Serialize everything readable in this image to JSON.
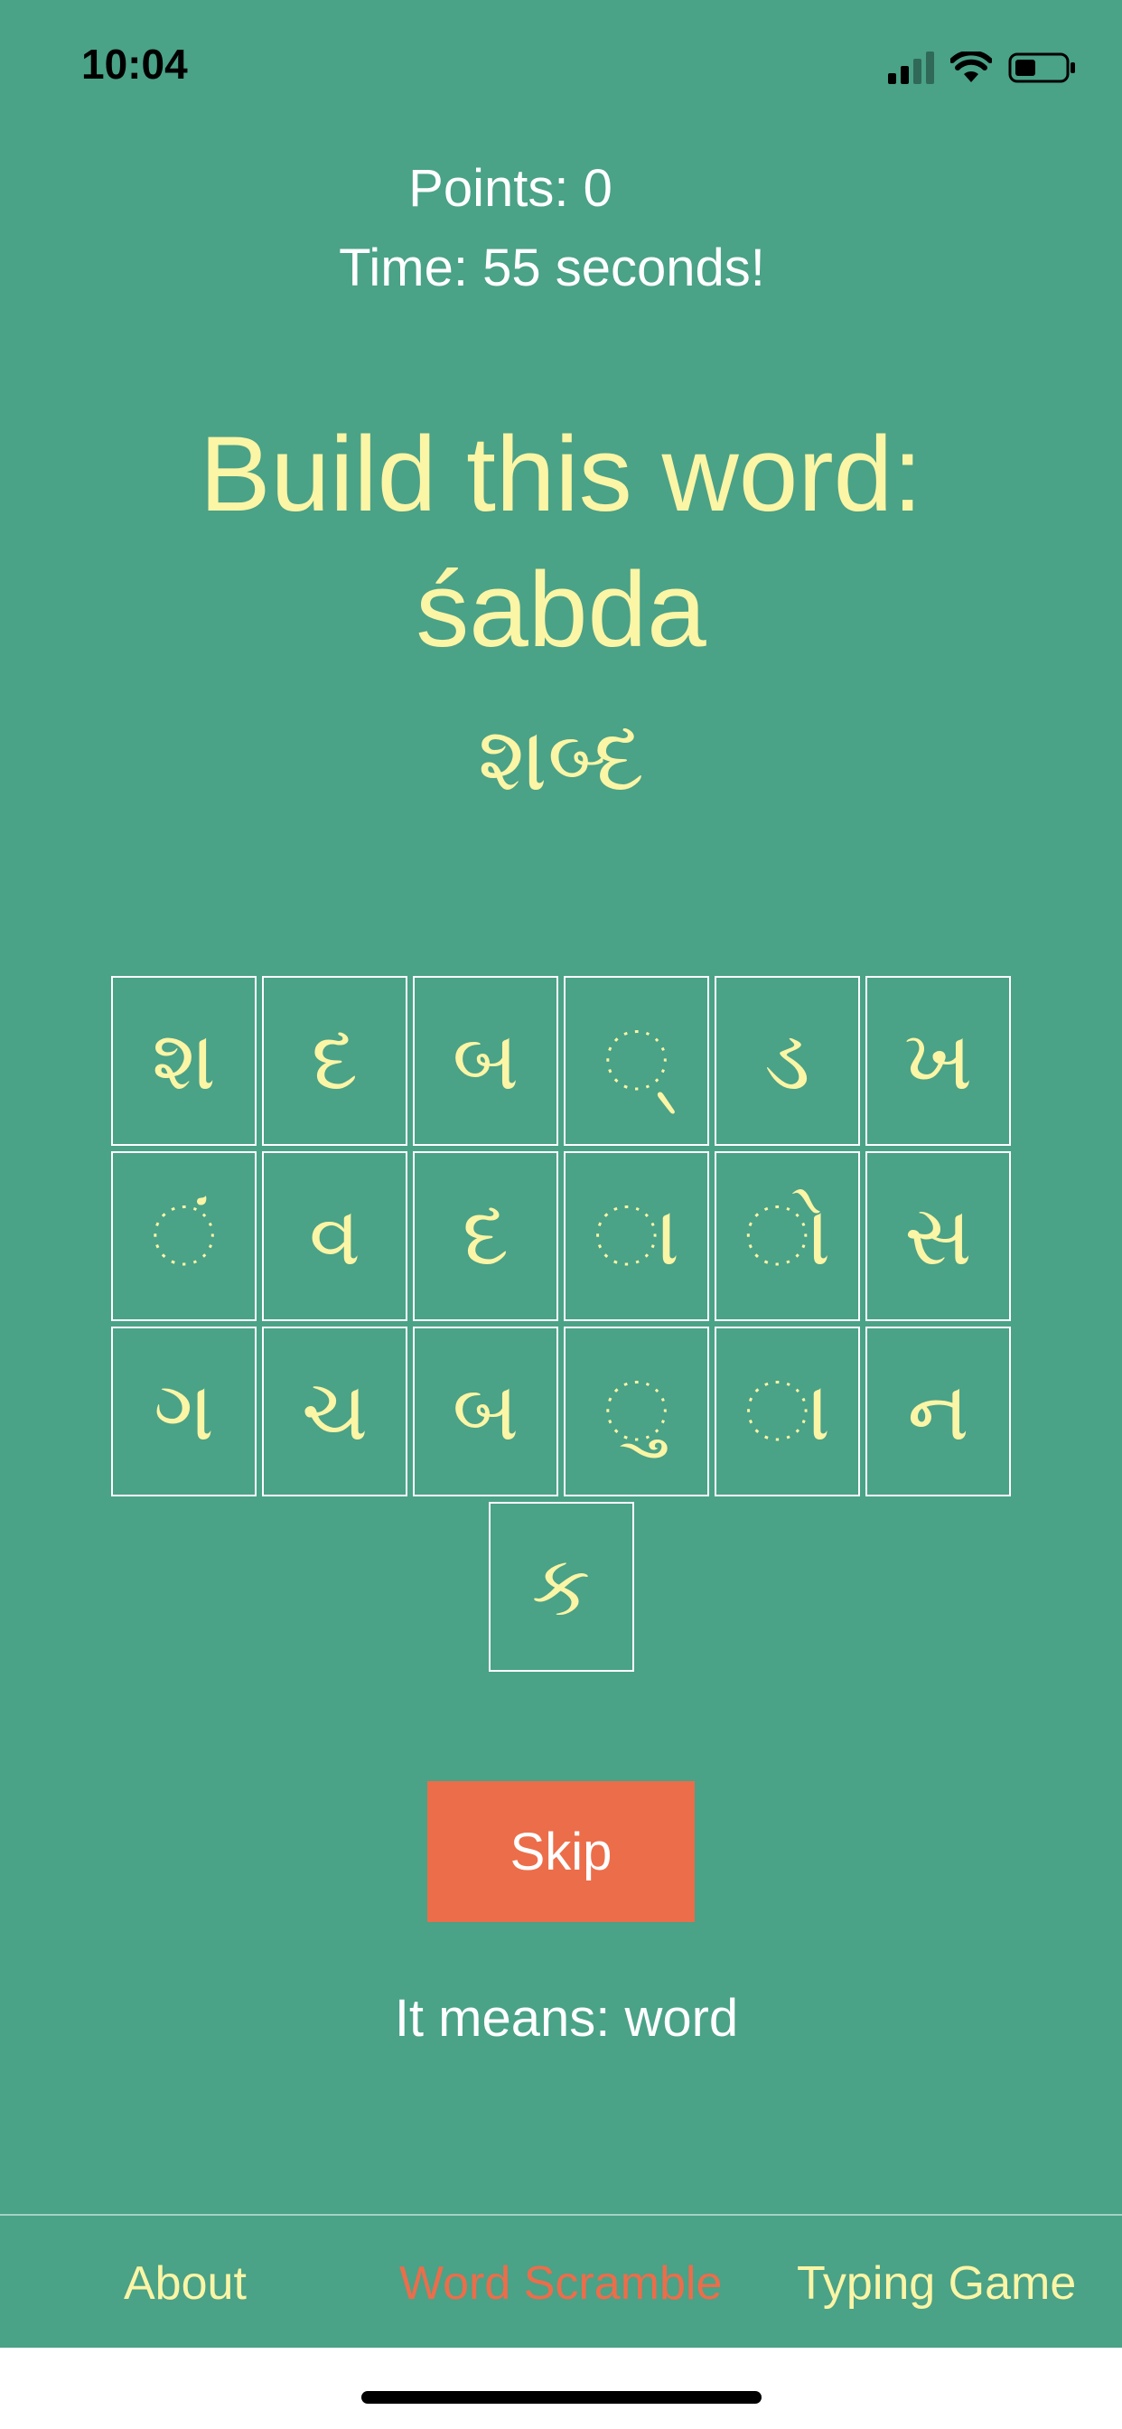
{
  "status_bar": {
    "time": "10:04"
  },
  "game": {
    "points_text": "Points: 0",
    "time_text": "Time: 55 seconds!",
    "prompt_label": "Build this word:",
    "target_transliteration": "śabda",
    "target_script": "શબ્દ"
  },
  "tiles": {
    "rows": [
      [
        "શ",
        "દ",
        "બ",
        "◌્",
        "ડ",
        "ખ"
      ],
      [
        "◌ં",
        "વ",
        "દ",
        "◌ા",
        "◌ો",
        "સ"
      ],
      [
        "ગ",
        "ચ",
        "બ",
        "◌ુ",
        "◌ા",
        "ન"
      ],
      [
        "ક"
      ]
    ]
  },
  "skip_button": {
    "label": "Skip"
  },
  "meaning": {
    "text": "It means: word"
  },
  "tab_bar": {
    "about": "About",
    "word_scramble": "Word Scramble",
    "typing_game": "Typing Game",
    "active": "word_scramble"
  },
  "colors": {
    "background": "#4aa287",
    "accent_yellow": "#fbf5a6",
    "skip_orange": "#ec6d4a",
    "tile_border": "#ffffff"
  },
  "icons": [
    "signal-icon",
    "wifi-icon",
    "battery-icon"
  ]
}
